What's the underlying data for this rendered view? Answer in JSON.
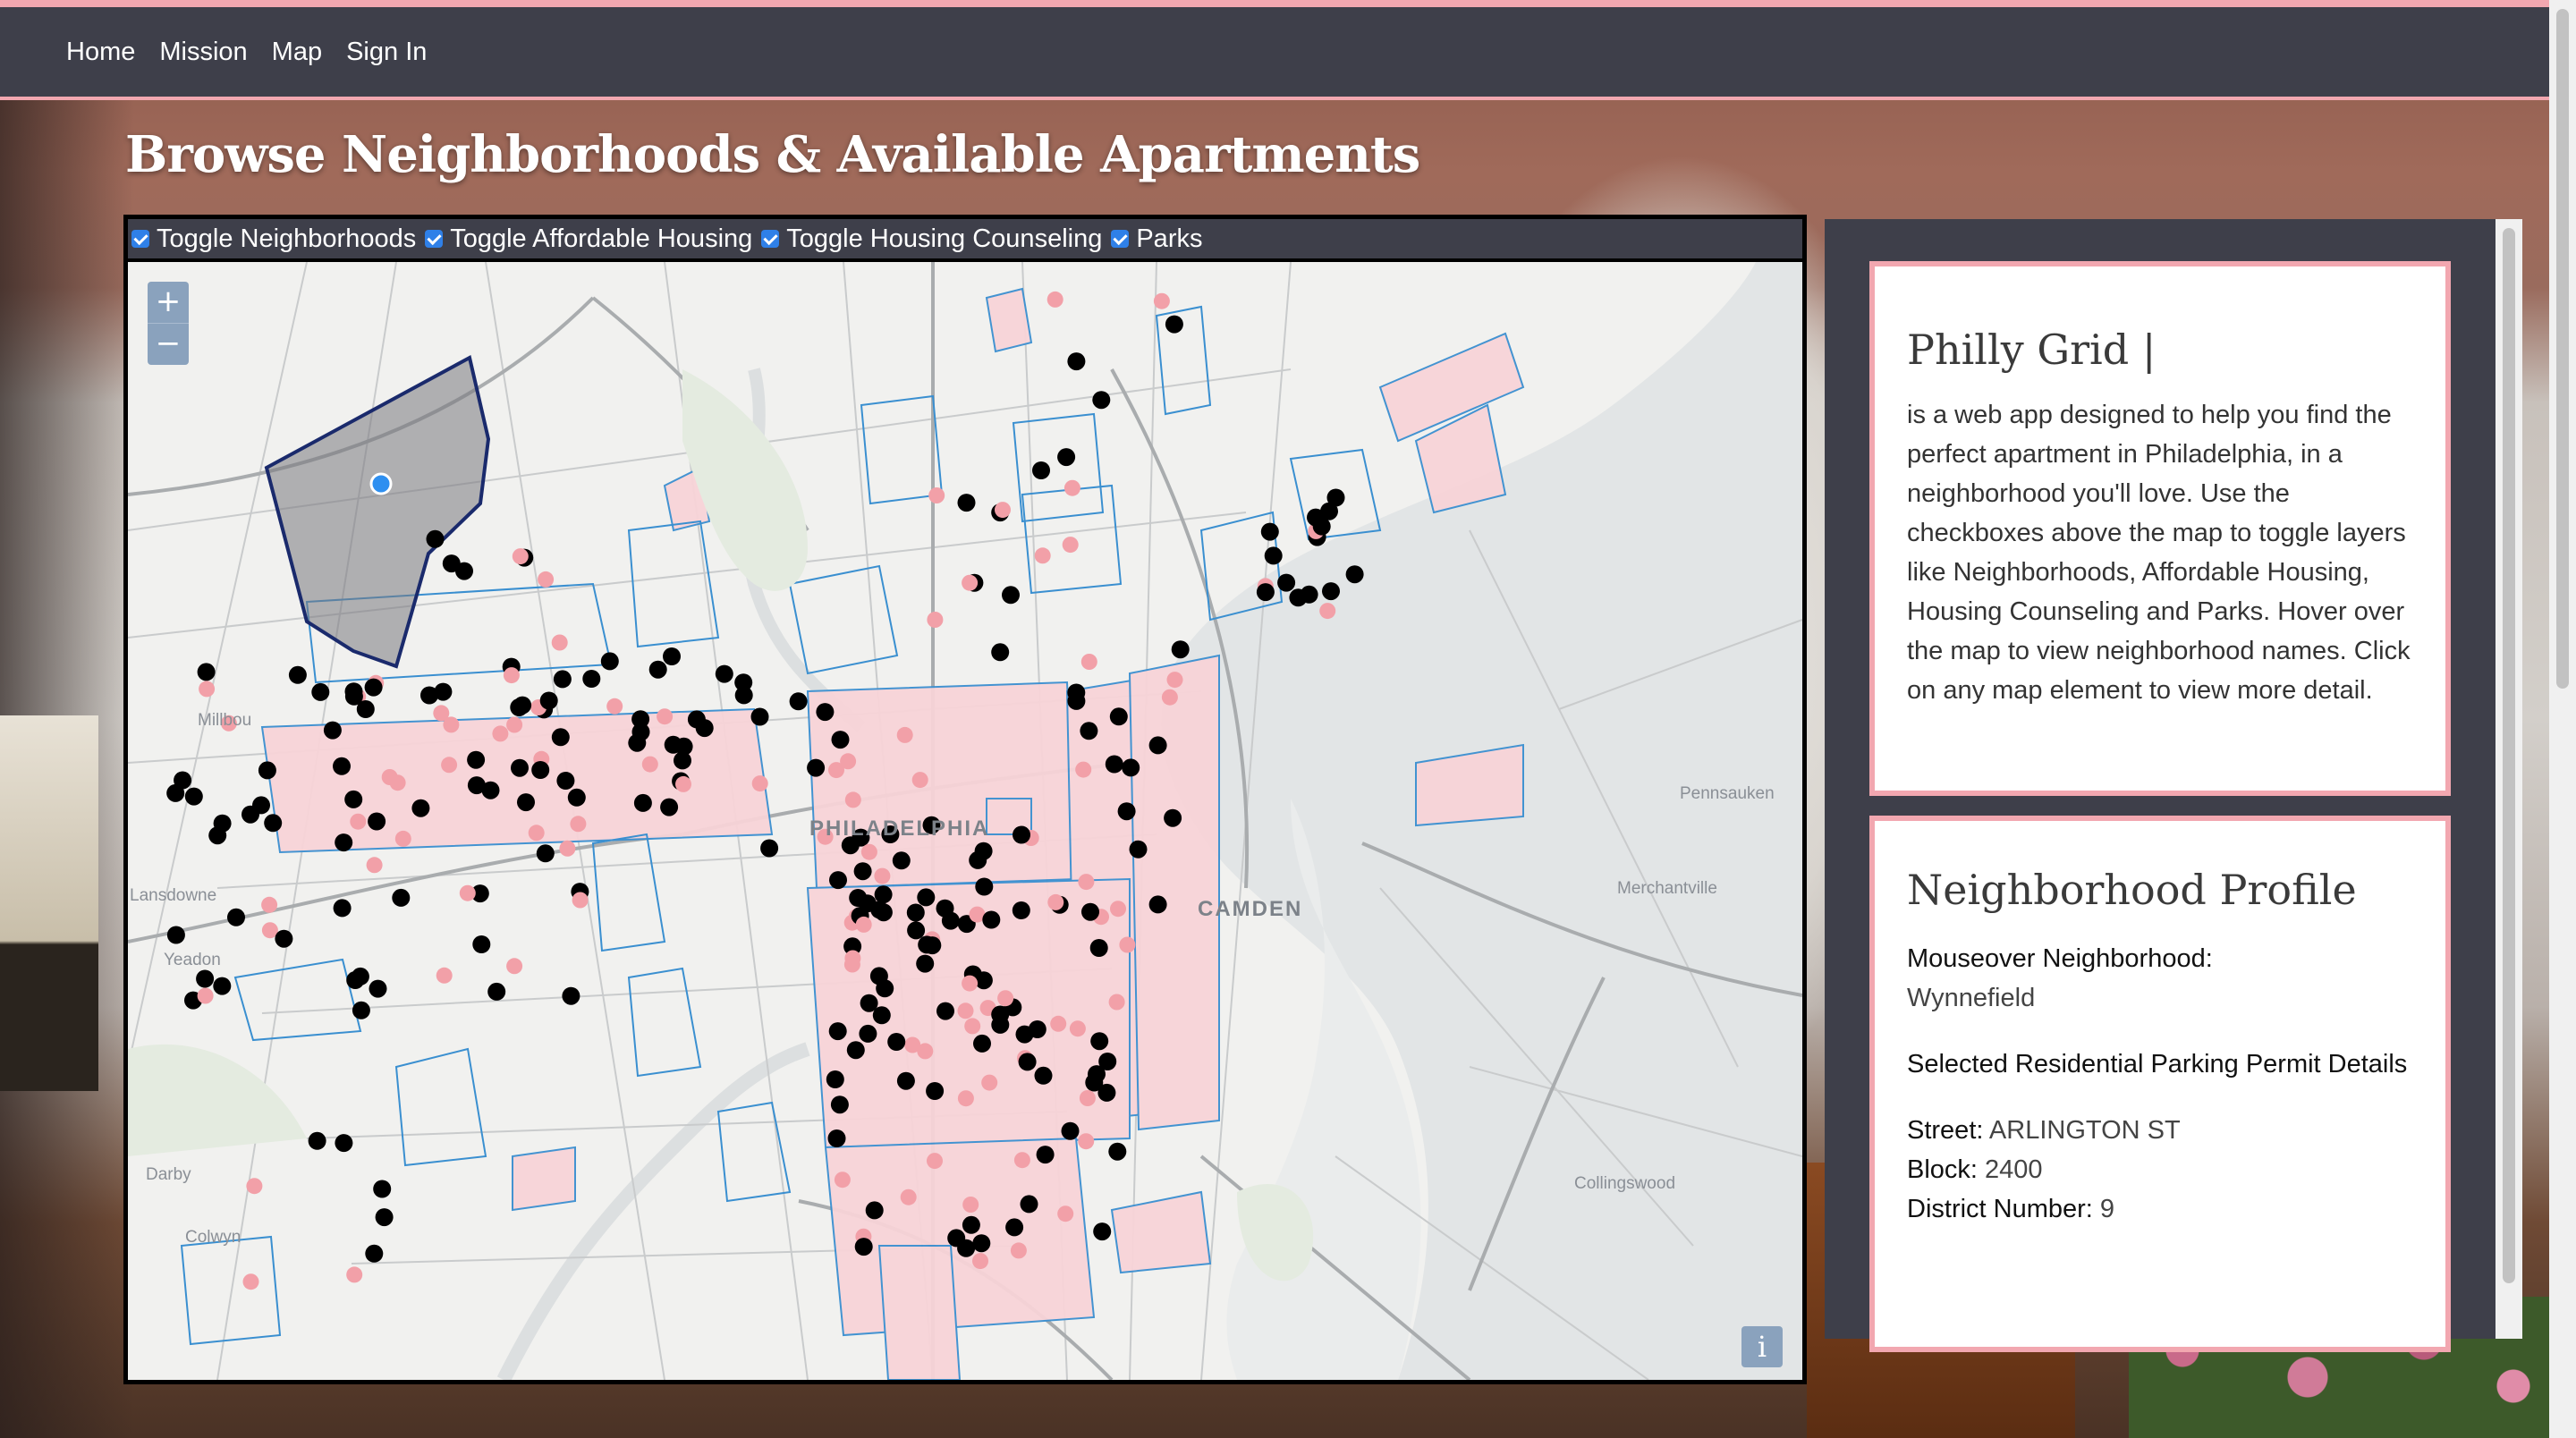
{
  "nav": {
    "items": [
      "Home",
      "Mission",
      "Map",
      "Sign In"
    ]
  },
  "page": {
    "title": "Browse Neighborhoods & Available Apartments"
  },
  "toggles": [
    {
      "label": "Toggle Neighborhoods",
      "checked": true
    },
    {
      "label": "Toggle Affordable Housing",
      "checked": true
    },
    {
      "label": "Toggle Housing Counseling",
      "checked": true
    },
    {
      "label": "Parks",
      "checked": true
    }
  ],
  "map": {
    "zoom_in": "+",
    "zoom_out": "−",
    "info": "i",
    "labels": {
      "philadelphia": "PHILADELPHIA",
      "camden": "CAMDEN",
      "pennsauken": "Pennsauken",
      "merchantville": "Merchantville",
      "collingswood": "Collingswood",
      "lansdowne": "Lansdowne",
      "yeadon": "Yeadon",
      "darby": "Darby",
      "colwyn": "Colwyn",
      "millbourne": "Millbou"
    },
    "colors": {
      "neighborhood": "#1a2a6c",
      "affordable": "#000000",
      "counseling": "#f2a0a8",
      "parking": "#3a8fd0"
    }
  },
  "about": {
    "title": "Philly Grid |",
    "body": "is a web app designed to help you find the perfect apartment in Philadelphia, in a neighborhood you'll love. Use the checkboxes above the map to toggle layers like Neighborhoods, Affordable Housing, Housing Counseling and Parks. Hover over the map to view neighborhood names. Click on any map element to view more detail."
  },
  "profile": {
    "title": "Neighborhood Profile",
    "mouseover_label": "Mouseover Neighborhood:",
    "mouseover_value": "Wynnefield",
    "permit_heading": "Selected Residential Parking Permit Details",
    "street_label": "Street:",
    "street_value": "ARLINGTON ST",
    "block_label": "Block:",
    "block_value": "2400",
    "district_label": "District Number:",
    "district_value": "9"
  }
}
